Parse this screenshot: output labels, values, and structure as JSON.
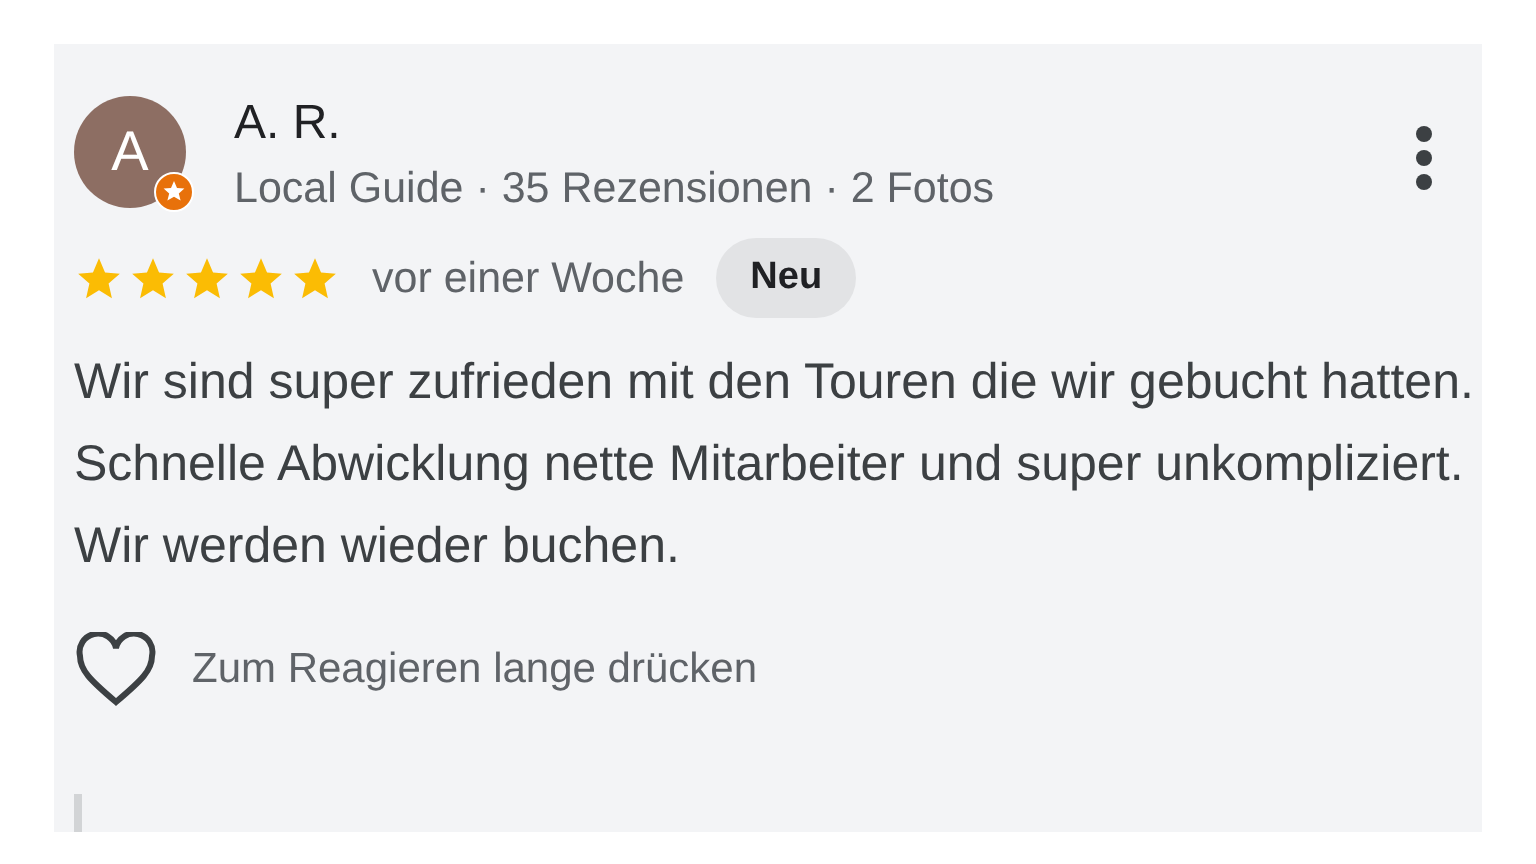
{
  "review": {
    "avatar_letter": "A",
    "local_guide_badge": true,
    "author": "A. R.",
    "meta": "Local Guide · 35 Rezensionen · 2 Fotos",
    "stars": 5,
    "time": "vor einer Woche",
    "badge": "Neu",
    "text": "Wir sind super zufrieden mit den Touren die wir gebucht hatten. Schnelle Abwicklung nette Mitarbeiter und super unkompliziert. Wir werden wieder buchen.",
    "react_hint": "Zum Reagieren lange drücken",
    "liked": false
  }
}
